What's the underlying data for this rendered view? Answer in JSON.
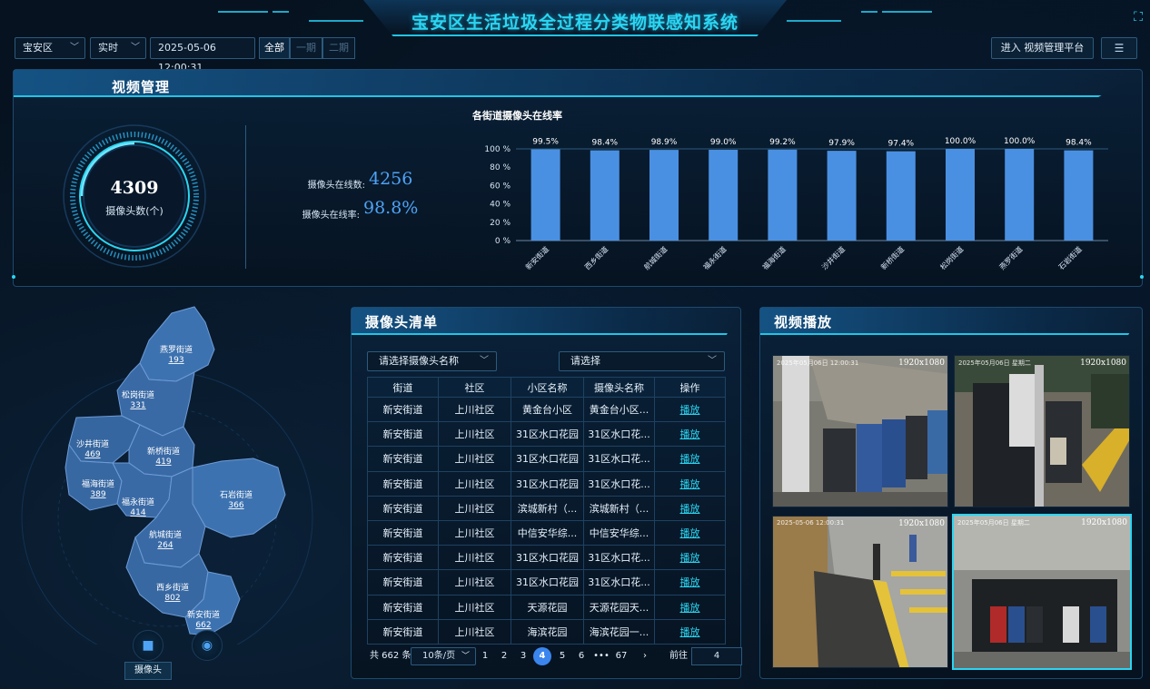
{
  "header": {
    "title": "宝安区生活垃圾全过程分类物联感知系统"
  },
  "controls": {
    "district": "宝安区",
    "mode": "实时",
    "datetime": "2025-05-06 12:00:31",
    "segments": [
      "全部",
      "一期",
      "二期"
    ],
    "enter_label": "进入 视频管理平台"
  },
  "video_mgmt": {
    "title": "视频管理",
    "total": "4309",
    "total_label": "摄像头数(个)",
    "online_count_label": "摄像头在线数:",
    "online_count": "4256",
    "online_rate_label": "摄像头在线率:",
    "online_rate": "98.8%"
  },
  "chart_data": {
    "type": "bar",
    "title": "各街道摄像头在线率",
    "categories": [
      "新安街道",
      "西乡街道",
      "航城街道",
      "福永街道",
      "福海街道",
      "沙井街道",
      "新桥街道",
      "松岗街道",
      "燕罗街道",
      "石岩街道"
    ],
    "values": [
      99.5,
      98.4,
      98.9,
      99.0,
      99.2,
      97.9,
      97.4,
      100.0,
      100.0,
      98.4
    ],
    "value_labels": [
      "99.5%",
      "98.4%",
      "98.9%",
      "99.0%",
      "99.2%",
      "97.9%",
      "97.4%",
      "100.0%",
      "100.0%",
      "98.4%"
    ],
    "yticks": [
      "0 %",
      "20 %",
      "40 %",
      "60 %",
      "80 %",
      "100 %"
    ],
    "ylim": [
      0,
      100
    ],
    "bar_color": "#4a90e2"
  },
  "map": {
    "streets": [
      {
        "name": "燕罗街道",
        "count": "193"
      },
      {
        "name": "松岗街道",
        "count": "331"
      },
      {
        "name": "沙井街道",
        "count": "469"
      },
      {
        "name": "新桥街道",
        "count": "419"
      },
      {
        "name": "福海街道",
        "count": "389"
      },
      {
        "name": "福永街道",
        "count": "414"
      },
      {
        "name": "石岩街道",
        "count": "366"
      },
      {
        "name": "航城街道",
        "count": "264"
      },
      {
        "name": "西乡街道",
        "count": "802"
      },
      {
        "name": "新安街道",
        "count": "662"
      }
    ],
    "camera_button_label": "摄像头"
  },
  "camera_list": {
    "title": "摄像头清单",
    "filter1_placeholder": "请选择摄像头名称",
    "filter2_placeholder": "请选择",
    "columns": [
      "街道",
      "社区",
      "小区名称",
      "摄像头名称",
      "操作"
    ],
    "rows": [
      [
        "新安街道",
        "上川社区",
        "黄金台小区",
        "黄金台小区...",
        "播放"
      ],
      [
        "新安街道",
        "上川社区",
        "31区水口花园",
        "31区水口花...",
        "播放"
      ],
      [
        "新安街道",
        "上川社区",
        "31区水口花园",
        "31区水口花...",
        "播放"
      ],
      [
        "新安街道",
        "上川社区",
        "31区水口花园",
        "31区水口花...",
        "播放"
      ],
      [
        "新安街道",
        "上川社区",
        "滨城新村（...",
        "滨城新村（...",
        "播放"
      ],
      [
        "新安街道",
        "上川社区",
        "中信安华综...",
        "中信安华综...",
        "播放"
      ],
      [
        "新安街道",
        "上川社区",
        "31区水口花园",
        "31区水口花...",
        "播放"
      ],
      [
        "新安街道",
        "上川社区",
        "31区水口花园",
        "31区水口花...",
        "播放"
      ],
      [
        "新安街道",
        "上川社区",
        "天源花园",
        "天源花园天...",
        "播放"
      ],
      [
        "新安街道",
        "上川社区",
        "海滨花园",
        "海滨花园一...",
        "播放"
      ]
    ],
    "pager": {
      "total": "共 662 条",
      "page_size": "10条/页",
      "pages": [
        "1",
        "2",
        "3",
        "4",
        "5",
        "6",
        "•••",
        "67"
      ],
      "current": "4",
      "goto_label": "前往",
      "goto_value": "4"
    }
  },
  "playback": {
    "title": "视频播放",
    "feeds": [
      {
        "resolution": "1920x1080",
        "timestamp": "2025年05月06日 12:00:31"
      },
      {
        "resolution": "1920x1080",
        "timestamp": "2025年05月06日 星期二"
      },
      {
        "resolution": "1920x1080",
        "timestamp": "2025-05-06 12:00:31"
      },
      {
        "resolution": "1920x1080",
        "timestamp": "2025年05月06日 星期二"
      }
    ]
  }
}
